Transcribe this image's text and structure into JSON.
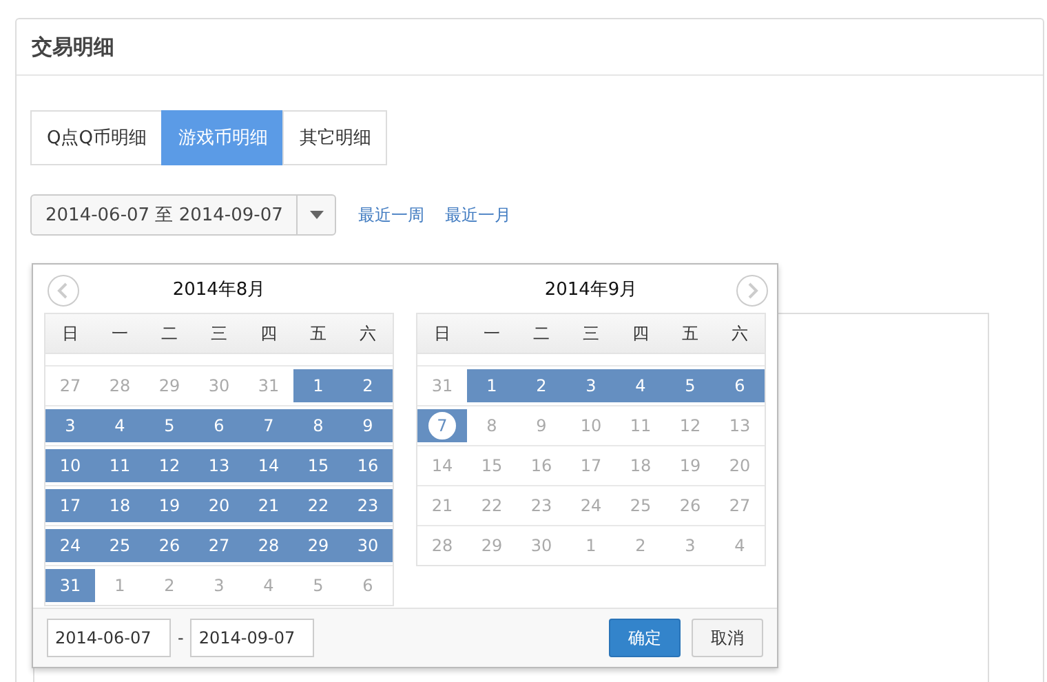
{
  "panel": {
    "title": "交易明细"
  },
  "tabs": [
    {
      "label": "Q点Q币明细",
      "selected": false
    },
    {
      "label": "游戏币明细",
      "selected": true
    },
    {
      "label": "其它明细",
      "selected": false
    }
  ],
  "date_range": {
    "value": "2014-06-07 至 2014-09-07",
    "links": [
      "最近一周",
      "最近一月"
    ]
  },
  "calendars": [
    {
      "title": "2014年8月",
      "prev_arrow": true,
      "next_arrow": false,
      "weekdays": [
        "日",
        "一",
        "二",
        "三",
        "四",
        "五",
        "六"
      ],
      "weeks": [
        [
          {
            "day": "27",
            "muted": true,
            "selected": false,
            "circled": false
          },
          {
            "day": "28",
            "muted": true,
            "selected": false,
            "circled": false
          },
          {
            "day": "29",
            "muted": true,
            "selected": false,
            "circled": false
          },
          {
            "day": "30",
            "muted": true,
            "selected": false,
            "circled": false
          },
          {
            "day": "31",
            "muted": true,
            "selected": false,
            "circled": false
          },
          {
            "day": "1",
            "muted": false,
            "selected": true,
            "circled": false
          },
          {
            "day": "2",
            "muted": false,
            "selected": true,
            "circled": false
          }
        ],
        [
          {
            "day": "3",
            "muted": false,
            "selected": true,
            "circled": false
          },
          {
            "day": "4",
            "muted": false,
            "selected": true,
            "circled": false
          },
          {
            "day": "5",
            "muted": false,
            "selected": true,
            "circled": false
          },
          {
            "day": "6",
            "muted": false,
            "selected": true,
            "circled": false
          },
          {
            "day": "7",
            "muted": false,
            "selected": true,
            "circled": false
          },
          {
            "day": "8",
            "muted": false,
            "selected": true,
            "circled": false
          },
          {
            "day": "9",
            "muted": false,
            "selected": true,
            "circled": false
          }
        ],
        [
          {
            "day": "10",
            "muted": false,
            "selected": true,
            "circled": false
          },
          {
            "day": "11",
            "muted": false,
            "selected": true,
            "circled": false
          },
          {
            "day": "12",
            "muted": false,
            "selected": true,
            "circled": false
          },
          {
            "day": "13",
            "muted": false,
            "selected": true,
            "circled": false
          },
          {
            "day": "14",
            "muted": false,
            "selected": true,
            "circled": false
          },
          {
            "day": "15",
            "muted": false,
            "selected": true,
            "circled": false
          },
          {
            "day": "16",
            "muted": false,
            "selected": true,
            "circled": false
          }
        ],
        [
          {
            "day": "17",
            "muted": false,
            "selected": true,
            "circled": false
          },
          {
            "day": "18",
            "muted": false,
            "selected": true,
            "circled": false
          },
          {
            "day": "19",
            "muted": false,
            "selected": true,
            "circled": false
          },
          {
            "day": "20",
            "muted": false,
            "selected": true,
            "circled": false
          },
          {
            "day": "21",
            "muted": false,
            "selected": true,
            "circled": false
          },
          {
            "day": "22",
            "muted": false,
            "selected": true,
            "circled": false
          },
          {
            "day": "23",
            "muted": false,
            "selected": true,
            "circled": false
          }
        ],
        [
          {
            "day": "24",
            "muted": false,
            "selected": true,
            "circled": false
          },
          {
            "day": "25",
            "muted": false,
            "selected": true,
            "circled": false
          },
          {
            "day": "26",
            "muted": false,
            "selected": true,
            "circled": false
          },
          {
            "day": "27",
            "muted": false,
            "selected": true,
            "circled": false
          },
          {
            "day": "28",
            "muted": false,
            "selected": true,
            "circled": false
          },
          {
            "day": "29",
            "muted": false,
            "selected": true,
            "circled": false
          },
          {
            "day": "30",
            "muted": false,
            "selected": true,
            "circled": false
          }
        ],
        [
          {
            "day": "31",
            "muted": false,
            "selected": true,
            "circled": false
          },
          {
            "day": "1",
            "muted": true,
            "selected": false,
            "circled": false
          },
          {
            "day": "2",
            "muted": true,
            "selected": false,
            "circled": false
          },
          {
            "day": "3",
            "muted": true,
            "selected": false,
            "circled": false
          },
          {
            "day": "4",
            "muted": true,
            "selected": false,
            "circled": false
          },
          {
            "day": "5",
            "muted": true,
            "selected": false,
            "circled": false
          },
          {
            "day": "6",
            "muted": true,
            "selected": false,
            "circled": false
          }
        ]
      ]
    },
    {
      "title": "2014年9月",
      "prev_arrow": false,
      "next_arrow": true,
      "weekdays": [
        "日",
        "一",
        "二",
        "三",
        "四",
        "五",
        "六"
      ],
      "weeks": [
        [
          {
            "day": "31",
            "muted": true,
            "selected": false,
            "circled": false
          },
          {
            "day": "1",
            "muted": false,
            "selected": true,
            "circled": false
          },
          {
            "day": "2",
            "muted": false,
            "selected": true,
            "circled": false
          },
          {
            "day": "3",
            "muted": false,
            "selected": true,
            "circled": false
          },
          {
            "day": "4",
            "muted": false,
            "selected": true,
            "circled": false
          },
          {
            "day": "5",
            "muted": false,
            "selected": true,
            "circled": false
          },
          {
            "day": "6",
            "muted": false,
            "selected": true,
            "circled": false
          }
        ],
        [
          {
            "day": "7",
            "muted": false,
            "selected": true,
            "circled": true
          },
          {
            "day": "8",
            "muted": true,
            "selected": false,
            "circled": false
          },
          {
            "day": "9",
            "muted": true,
            "selected": false,
            "circled": false
          },
          {
            "day": "10",
            "muted": true,
            "selected": false,
            "circled": false
          },
          {
            "day": "11",
            "muted": true,
            "selected": false,
            "circled": false
          },
          {
            "day": "12",
            "muted": true,
            "selected": false,
            "circled": false
          },
          {
            "day": "13",
            "muted": true,
            "selected": false,
            "circled": false
          }
        ],
        [
          {
            "day": "14",
            "muted": true,
            "selected": false,
            "circled": false
          },
          {
            "day": "15",
            "muted": true,
            "selected": false,
            "circled": false
          },
          {
            "day": "16",
            "muted": true,
            "selected": false,
            "circled": false
          },
          {
            "day": "17",
            "muted": true,
            "selected": false,
            "circled": false
          },
          {
            "day": "18",
            "muted": true,
            "selected": false,
            "circled": false
          },
          {
            "day": "19",
            "muted": true,
            "selected": false,
            "circled": false
          },
          {
            "day": "20",
            "muted": true,
            "selected": false,
            "circled": false
          }
        ],
        [
          {
            "day": "21",
            "muted": true,
            "selected": false,
            "circled": false
          },
          {
            "day": "22",
            "muted": true,
            "selected": false,
            "circled": false
          },
          {
            "day": "23",
            "muted": true,
            "selected": false,
            "circled": false
          },
          {
            "day": "24",
            "muted": true,
            "selected": false,
            "circled": false
          },
          {
            "day": "25",
            "muted": true,
            "selected": false,
            "circled": false
          },
          {
            "day": "26",
            "muted": true,
            "selected": false,
            "circled": false
          },
          {
            "day": "27",
            "muted": true,
            "selected": false,
            "circled": false
          }
        ],
        [
          {
            "day": "28",
            "muted": true,
            "selected": false,
            "circled": false
          },
          {
            "day": "29",
            "muted": true,
            "selected": false,
            "circled": false
          },
          {
            "day": "30",
            "muted": true,
            "selected": false,
            "circled": false
          },
          {
            "day": "1",
            "muted": true,
            "selected": false,
            "circled": false
          },
          {
            "day": "2",
            "muted": true,
            "selected": false,
            "circled": false
          },
          {
            "day": "3",
            "muted": true,
            "selected": false,
            "circled": false
          },
          {
            "day": "4",
            "muted": true,
            "selected": false,
            "circled": false
          }
        ]
      ]
    }
  ],
  "footer": {
    "start": "2014-06-07",
    "separator": "-",
    "end": "2014-09-07",
    "buttons": [
      {
        "label": "确定",
        "kind": "primary"
      },
      {
        "label": "取消",
        "kind": "default"
      }
    ]
  }
}
